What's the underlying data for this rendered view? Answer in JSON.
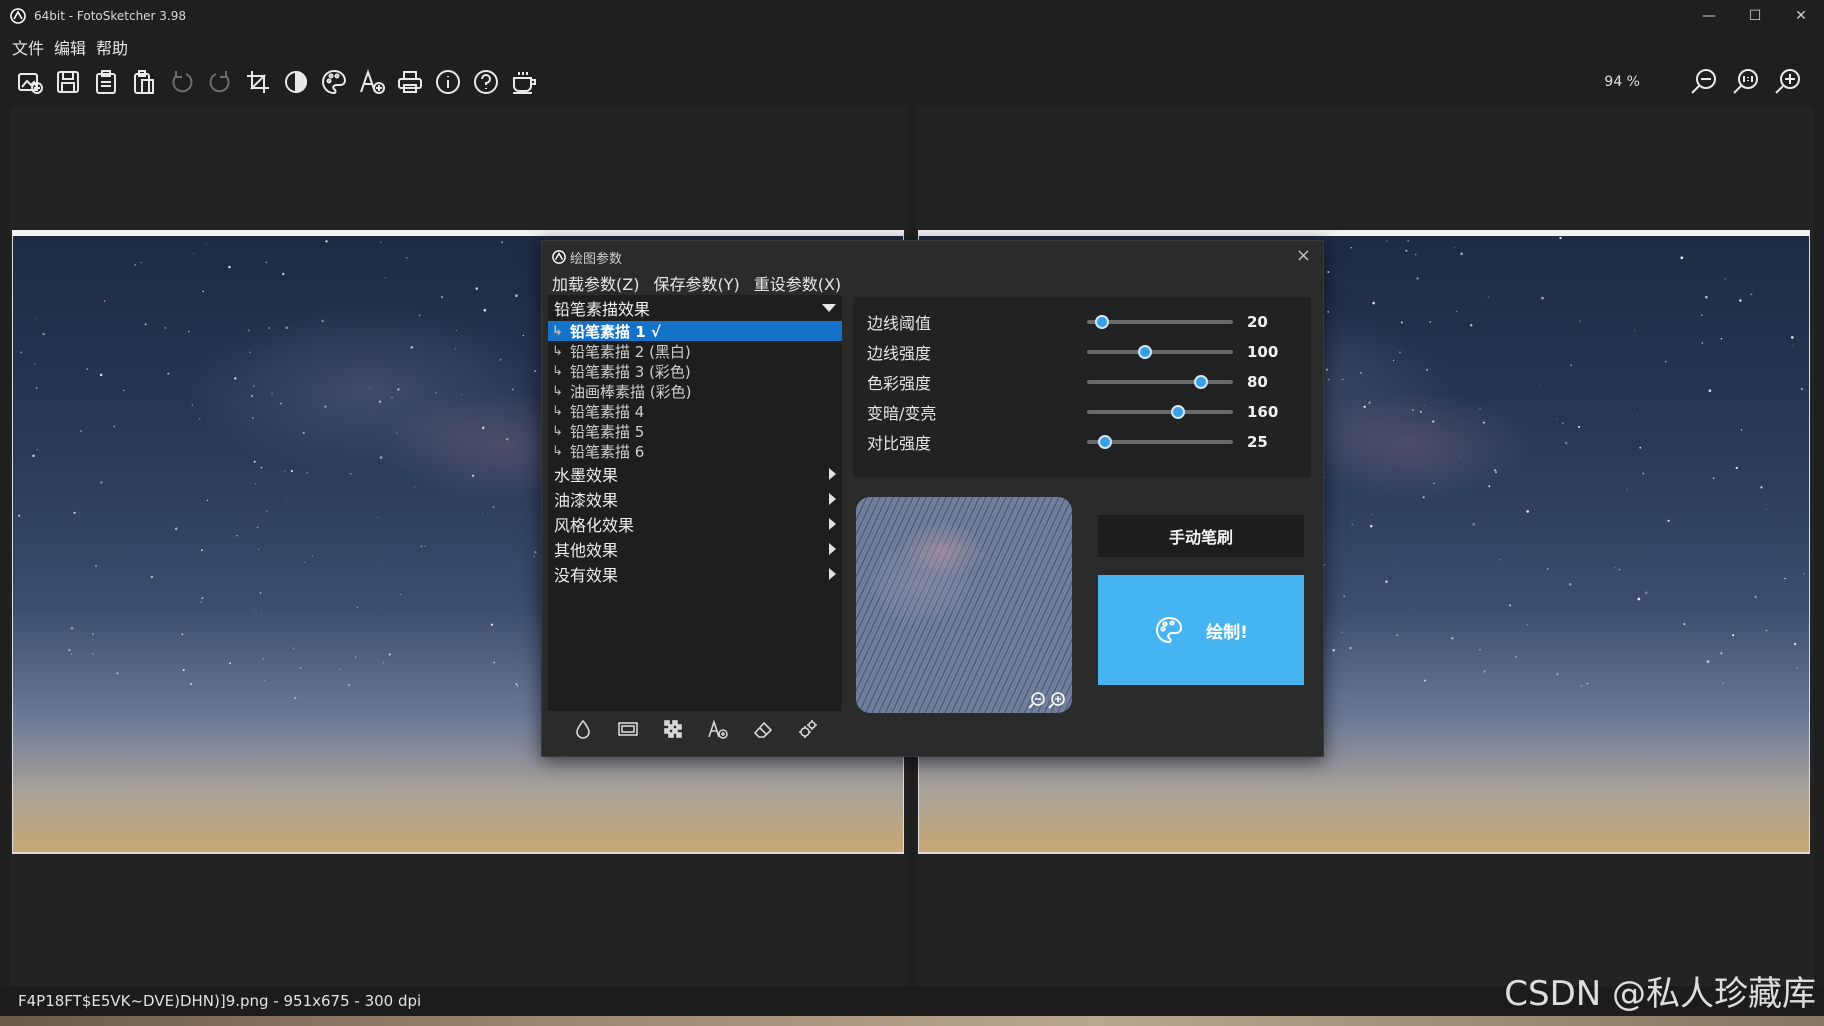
{
  "window": {
    "title": "64bit - FotoSketcher 3.98",
    "controls": [
      "—",
      "☐",
      "✕"
    ]
  },
  "menu": [
    "文件",
    "编辑",
    "帮助"
  ],
  "toolbar": {
    "icons": [
      "open-image-icon",
      "save-icon",
      "save-clipboard-icon",
      "paste-icon",
      "undo-icon",
      "redo-icon",
      "crop-icon",
      "contrast-icon",
      "palette-icon",
      "add-text-icon",
      "print-icon",
      "info-icon",
      "help-icon",
      "coffee-icon"
    ]
  },
  "zoom": {
    "level": "94 %",
    "icons": [
      "zoom-out-icon",
      "zoom-actual-icon",
      "zoom-in-icon"
    ]
  },
  "status": {
    "file_info": "F4P18FT$E5VK~DVE)DHN)]9.png - 951x675 - 300 dpi"
  },
  "watermark": "CSDN @私人珍藏库",
  "dialog": {
    "title": "绘图参数",
    "close": "×",
    "menu": [
      "加载参数(Z)",
      "保存参数(Y)",
      "重设参数(X)"
    ],
    "effects": {
      "expanded_group": "铅笔素描效果",
      "items": [
        "铅笔素描 1 √",
        "铅笔素描 2 (黑白)",
        "铅笔素描 3 (彩色)",
        "油画棒素描 (彩色)",
        "铅笔素描 4",
        "铅笔素描 5",
        "铅笔素描 6"
      ],
      "selected_index": 0,
      "groups": [
        "水墨效果",
        "油漆效果",
        "风格化效果",
        "其他效果",
        "没有效果"
      ]
    },
    "params": [
      {
        "label": "边线阈值",
        "value": "20",
        "fraction": 0.1
      },
      {
        "label": "边线强度",
        "value": "100",
        "fraction": 0.4
      },
      {
        "label": "色彩强度",
        "value": "80",
        "fraction": 0.78
      },
      {
        "label": "变暗/变亮",
        "value": "160",
        "fraction": 0.62
      },
      {
        "label": "对比强度",
        "value": "25",
        "fraction": 0.12
      }
    ],
    "manual_brush": "手动笔刷",
    "draw": "绘制!",
    "accent_color": "#46b4f0",
    "selected_color": "#1472c8"
  }
}
